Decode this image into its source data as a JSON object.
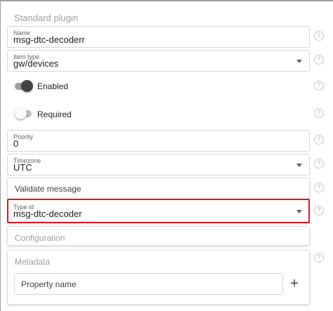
{
  "section_title": "Standard plugin",
  "fields": {
    "name": {
      "label": "Name",
      "value": "msg-dtc-decoderr"
    },
    "item_type": {
      "label": "Item type",
      "value": "gw/devices"
    },
    "priority": {
      "label": "Priority",
      "value": "0"
    },
    "timezone": {
      "label": "Timezone",
      "value": "UTC"
    },
    "type_id": {
      "label": "Type id",
      "value": "msg-dtc-decoder"
    }
  },
  "toggles": {
    "enabled": {
      "label": "Enabled",
      "checked": true
    },
    "required": {
      "label": "Required",
      "checked": false
    }
  },
  "panels": {
    "validate_message": "Validate message",
    "configuration": "Configuration",
    "metadata": "Metadata"
  },
  "metadata": {
    "property_placeholder": "Property name",
    "add_symbol": "+"
  },
  "help_symbol": "?",
  "colors": {
    "highlight": "#e0141b",
    "toggle_on_knob": "#424242",
    "muted_text": "#9e9e9e"
  }
}
